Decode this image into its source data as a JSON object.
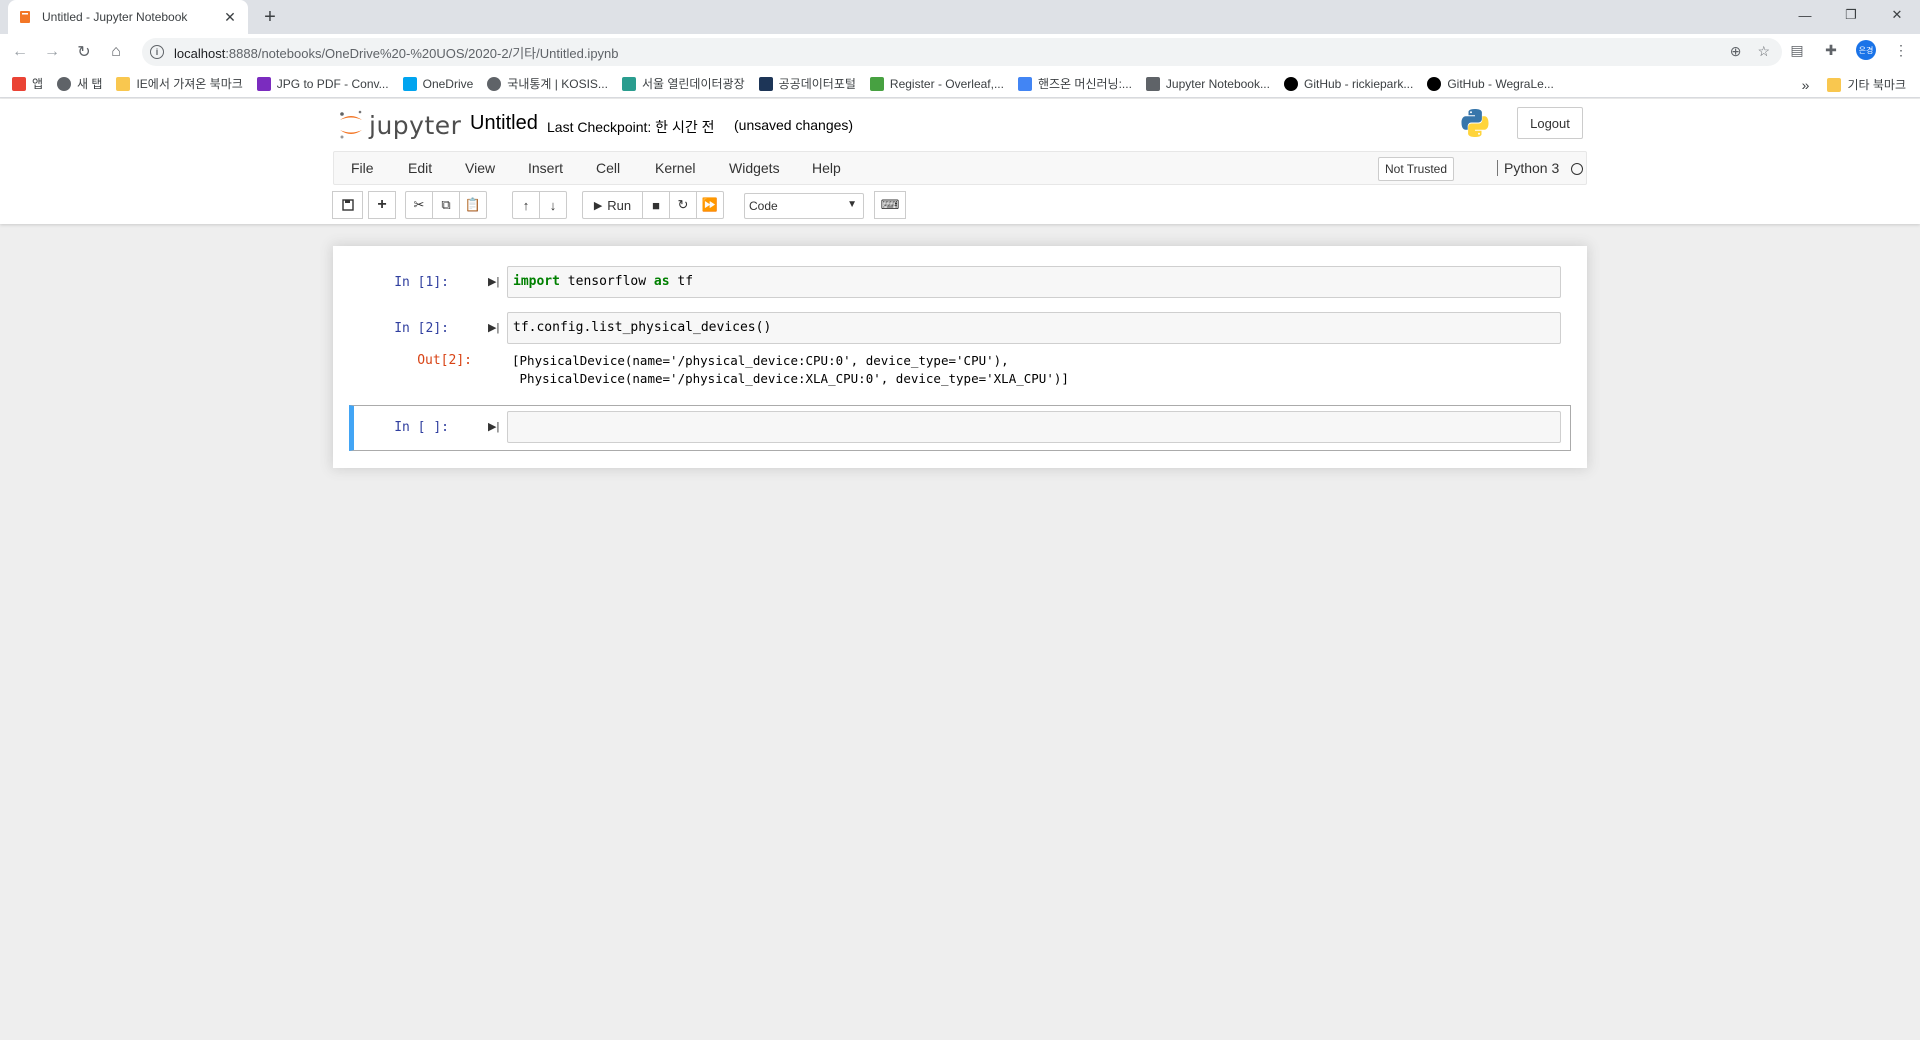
{
  "browser": {
    "tab_title": "Untitled - Jupyter Notebook",
    "url_host": "localhost",
    "url_path": ":8888/notebooks/OneDrive%20-%20UOS/2020-2/기타/Untitled.ipynb",
    "avatar_text": "은경"
  },
  "bookmarks": [
    {
      "label": "앱",
      "icon": "apps-grid-icon",
      "color": "#ea4335"
    },
    {
      "label": "새 탭",
      "icon": "globe-icon",
      "color": "#5f6368"
    },
    {
      "label": "IE에서 가져온 북마크",
      "icon": "folder-icon",
      "color": "#f9c74f"
    },
    {
      "label": "JPG to PDF - Conv...",
      "icon": "jpg2pdf-icon",
      "color": "#7b2cbf"
    },
    {
      "label": "OneDrive",
      "icon": "ms-logo-icon",
      "color": "#00a4ef"
    },
    {
      "label": "국내통계 | KOSIS...",
      "icon": "globe-icon",
      "color": "#5f6368"
    },
    {
      "label": "서울 열린데이터광장",
      "icon": "seoul-icon",
      "color": "#2a9d8f"
    },
    {
      "label": "공공데이터포털",
      "icon": "data-portal-icon",
      "color": "#1d3557"
    },
    {
      "label": "Register - Overleaf,...",
      "icon": "overleaf-icon",
      "color": "#47a141"
    },
    {
      "label": "핸즈온 머신러닝:...",
      "icon": "google-icon",
      "color": "#4285f4"
    },
    {
      "label": "Jupyter Notebook...",
      "icon": "doc-icon",
      "color": "#5f6368"
    },
    {
      "label": "GitHub - rickiepark...",
      "icon": "github-icon",
      "color": "#000000"
    },
    {
      "label": "GitHub - WegraLe...",
      "icon": "github-icon",
      "color": "#000000"
    }
  ],
  "bookmarks_overflow": "»",
  "bookmarks_other": "기타 북마크",
  "jupyter": {
    "logo_text": "jupyter",
    "notebook_title": "Untitled",
    "checkpoint": "Last Checkpoint: 한 시간 전",
    "autosave_status": "(unsaved changes)",
    "logout_label": "Logout",
    "menu": [
      "File",
      "Edit",
      "View",
      "Insert",
      "Cell",
      "Kernel",
      "Widgets",
      "Help"
    ],
    "trust_label": "Not Trusted",
    "kernel_name": "Python 3",
    "run_label": "Run",
    "cell_type": "Code"
  },
  "cells": [
    {
      "prompt": "In [1]:",
      "code_kw": "import",
      "code_mid": " tensorflow ",
      "code_kw2": "as",
      "code_end": " tf"
    },
    {
      "prompt": "In [2]:",
      "code": "tf.config.list_physical_devices()",
      "out_prompt": "Out[2]:",
      "output_line1": "[PhysicalDevice(name='/physical_device:CPU:0', device_type='CPU'),",
      "output_line2": " PhysicalDevice(name='/physical_device:XLA_CPU:0', device_type='XLA_CPU')]"
    },
    {
      "prompt": "In [ ]:",
      "code": ""
    }
  ],
  "colors": {
    "accent_selected": "#42a5f5",
    "in_prompt": "#303f9f",
    "out_prompt": "#d84315",
    "keyword": "#008000",
    "jupyter_orange": "#f37626"
  }
}
